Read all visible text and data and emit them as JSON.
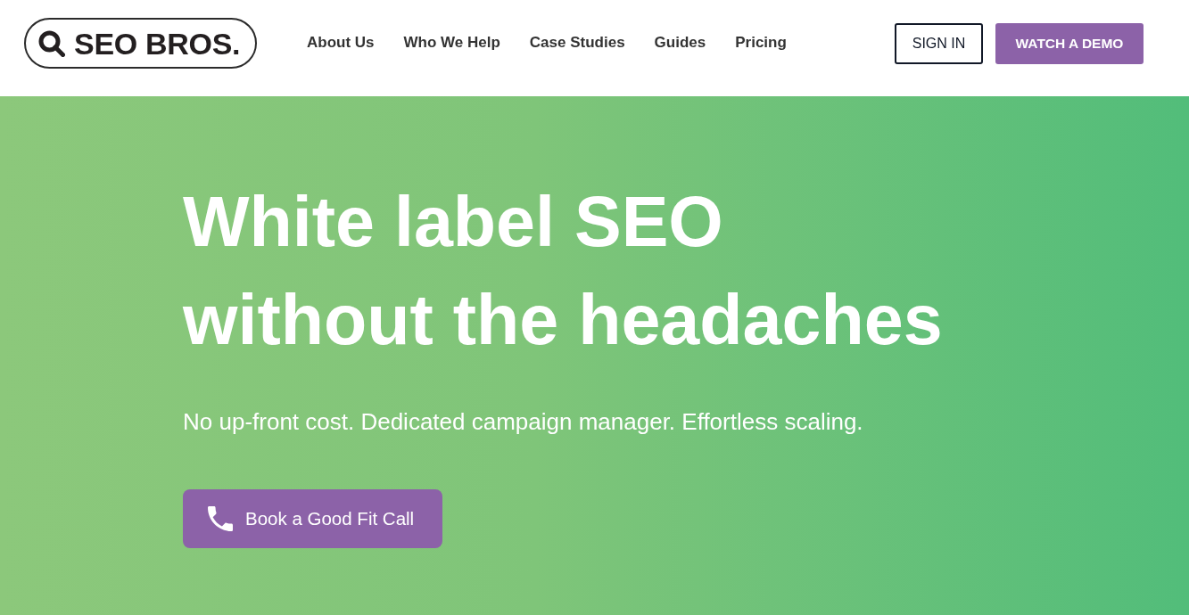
{
  "header": {
    "logo": {
      "text": "SEO BROS."
    },
    "nav": [
      {
        "label": "About Us"
      },
      {
        "label": "Who We Help"
      },
      {
        "label": "Case Studies"
      },
      {
        "label": "Guides"
      },
      {
        "label": "Pricing"
      }
    ],
    "buttons": [
      {
        "label": "SIGN IN",
        "kind": "outline"
      },
      {
        "label": "WATCH A DEMO",
        "kind": "filled"
      }
    ]
  },
  "hero": {
    "heading_lines": [
      "White label SEO",
      "without the headaches"
    ],
    "subtitle": "No up-front cost. Dedicated campaign manager. Effortless scaling.",
    "cta": {
      "label": "Book a Good Fit Call"
    }
  }
}
